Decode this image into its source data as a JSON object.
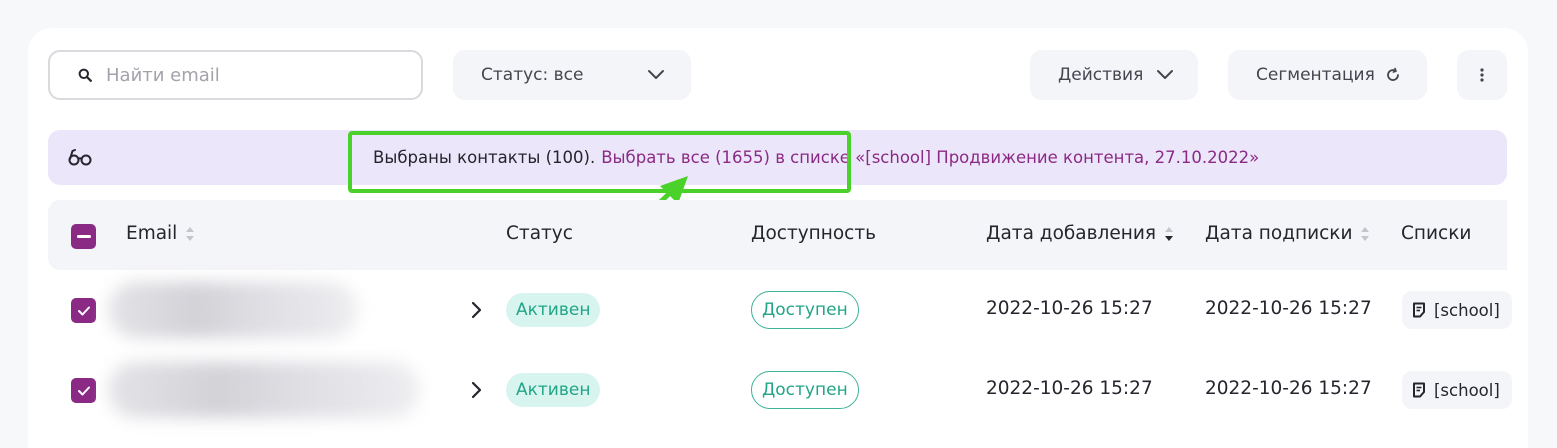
{
  "search": {
    "placeholder": "Найти email"
  },
  "filters": {
    "status_label": "Статус: все",
    "actions_label": "Действия",
    "segmentation_label": "Сегментация"
  },
  "banner": {
    "selected_text": "Выбраны контакты (100).",
    "select_all_link": "Выбрать все (1655) в списке «[school] Продвижение контента, 27.10.2022»"
  },
  "table": {
    "columns": [
      "Email",
      "Статус",
      "Доступность",
      "Дата добавления",
      "Дата подписки",
      "Списки"
    ],
    "rows": [
      {
        "status": "Активен",
        "availability": "Доступен",
        "added": "2022-10-26 15:27",
        "subscribed": "2022-10-26 15:27",
        "list": "[school]"
      },
      {
        "status": "Активен",
        "availability": "Доступен",
        "added": "2022-10-26 15:27",
        "subscribed": "2022-10-26 15:27",
        "list": "[school]"
      }
    ]
  },
  "colors": {
    "accent": "#8a2a84",
    "banner_bg": "#ece6fa",
    "status_green": "#21a586",
    "annotation_green": "#4ad12a"
  }
}
